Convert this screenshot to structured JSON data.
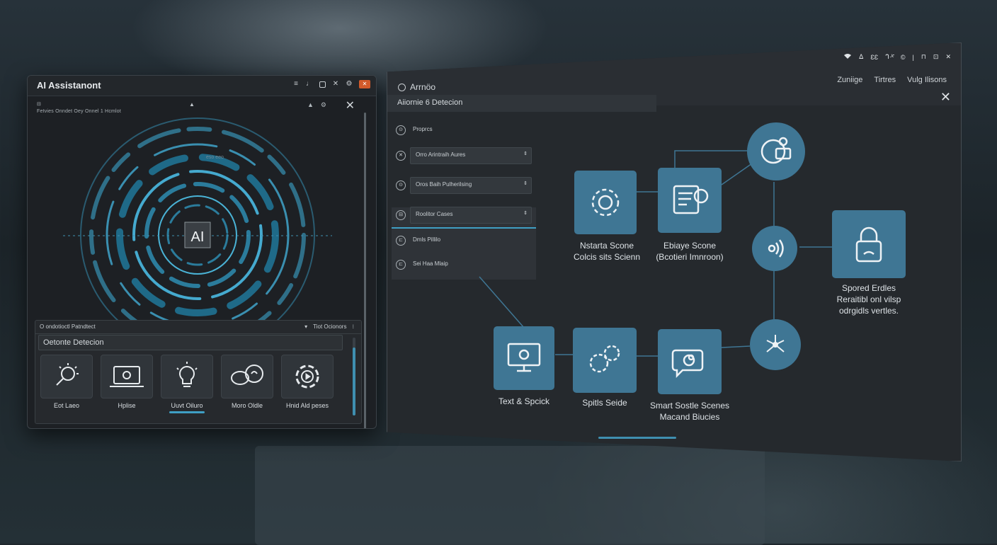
{
  "left_window": {
    "title": "AI Assistanont",
    "subtitle": "Fetvies  Onndet  Oey  Onnel 1 Hcmlot",
    "radial_caption": "eso eeo",
    "center_label": "AI",
    "controls": [
      "≡",
      "♩",
      "⊙",
      "✕",
      "⚙"
    ],
    "mini_controls": [
      "▲",
      "⚙"
    ],
    "detection": {
      "header_left": "O ondotioctl Patndtect",
      "header_right": "Tiot Ocionors",
      "title": "Oetonte Detecion",
      "tiles": [
        {
          "label": "Eot Laeo",
          "icon": "bulb-search-icon"
        },
        {
          "label": "Hplise",
          "icon": "laptop-icon"
        },
        {
          "label": "Uuvt Oiluro",
          "icon": "lightbulb-icon",
          "active": true
        },
        {
          "label": "Moro Oldle",
          "icon": "chat-bubbles-icon"
        },
        {
          "label": "Hnid Ald peses",
          "icon": "gear-play-icon"
        }
      ]
    }
  },
  "right_window": {
    "header_title": "Arrnöo",
    "subtitle": "Aiiornie 6 Detecion",
    "menu": [
      "Zuniige",
      "Tirtres",
      "Vulg Ilisons"
    ],
    "status_icons": [
      "wifi",
      "ᐃ",
      "ƐƐ",
      "ᒉ·ᵏ̄",
      "©",
      "⊡",
      "⊓"
    ],
    "side_items": [
      {
        "label": "Proprcs",
        "icon": "⊙"
      },
      {
        "label": "Orro Arintraih Aures",
        "icon": "✕"
      },
      {
        "label": "Oros Baih Pulherilsing",
        "icon": "⊙"
      },
      {
        "label": "Roolitor Cases",
        "icon": "⊟"
      },
      {
        "label": "Dmls Pillilo",
        "icon": "⊏"
      },
      {
        "label": "Sei Haa Mlaip",
        "icon": "⊏"
      }
    ],
    "nodes": [
      {
        "label": "Nstarta Scone\nColcis sits Scienn",
        "icon": "gear-icon"
      },
      {
        "label": "Ebiaye Scone\n(Bcotieri Imnroon)",
        "icon": "document-chat-icon"
      },
      {
        "label": "",
        "icon": "target-camera-icon"
      },
      {
        "label": "",
        "icon": "audio-wave-icon"
      },
      {
        "label": "Spored Erdles\nReraitibl onl vilsp\nodrgidls vertles.",
        "icon": "lock-icon"
      },
      {
        "label": "Text & Spcick",
        "icon": "monitor-icon"
      },
      {
        "label": "Spitls Seide",
        "icon": "gears-icon"
      },
      {
        "label": "Smart Sostle Scenes\nMacand Biucies",
        "icon": "chat-bubble-icon"
      },
      {
        "label": "",
        "icon": "network-icon"
      }
    ]
  },
  "colors": {
    "accent": "#3f9fc4",
    "node_fill": "#3f7694",
    "window_bg": "#25292d"
  }
}
